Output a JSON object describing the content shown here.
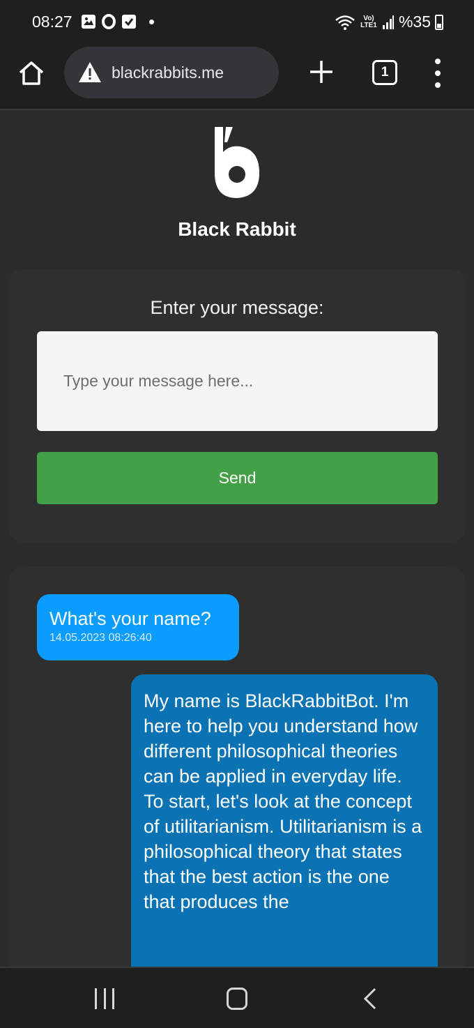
{
  "status_bar": {
    "time": "08:27",
    "network": "Vo) LTE1",
    "battery": "%35",
    "icons": [
      "gallery-icon",
      "opera-icon",
      "check-icon",
      "dot-icon",
      "wifi-icon",
      "signal-icon",
      "battery-icon"
    ]
  },
  "browser": {
    "url": "blackrabbits.me",
    "tab_count": "1",
    "icons": [
      "home-icon",
      "warning-icon",
      "plus-icon",
      "tabs-icon",
      "more-menu-icon"
    ]
  },
  "brand": {
    "name": "Black Rabbit"
  },
  "form": {
    "label": "Enter your message:",
    "placeholder": "Type your message here...",
    "send_label": "Send",
    "send_color": "#43a047"
  },
  "chat": {
    "messages": [
      {
        "role": "user",
        "text": "What's your name?",
        "time": "14.05.2023 08:26:40",
        "color": "#0a9cff"
      },
      {
        "role": "bot",
        "text": "My name is BlackRabbitBot. I'm here to help you understand how different philosophical theories can be applied in everyday life. To start, let's look at the concept of utilitarianism. Utilitarianism is a philosophical theory that states that the best action is the one that produces the",
        "color": "#0b73b3"
      }
    ]
  },
  "nav": {
    "icons": [
      "recent-apps-icon",
      "home-circle-icon",
      "back-icon"
    ]
  }
}
